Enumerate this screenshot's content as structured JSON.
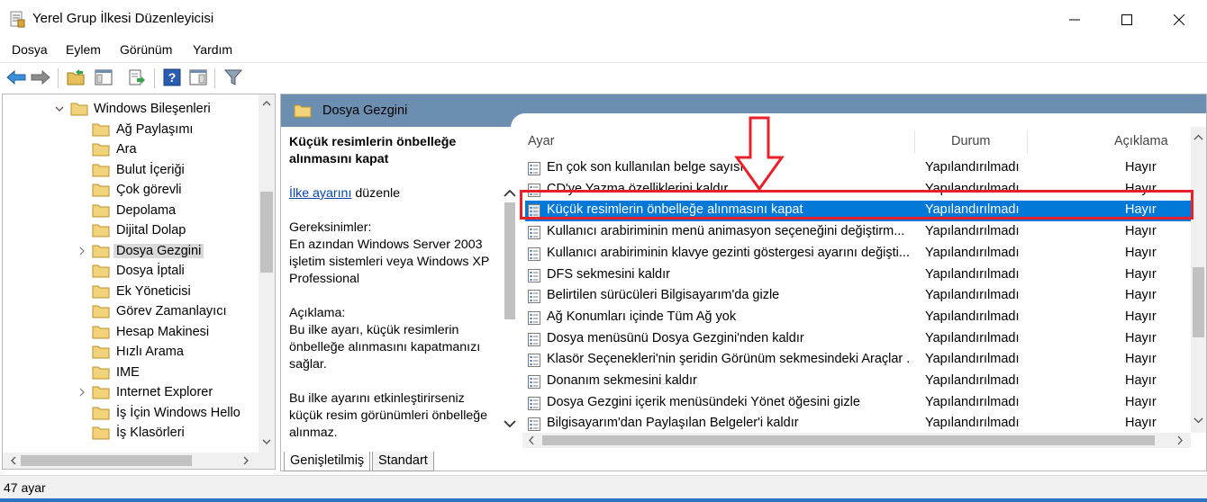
{
  "window": {
    "title": "Yerel Grup İlkesi Düzenleyicisi"
  },
  "menubar": {
    "items": [
      "Dosya",
      "Eylem",
      "Görünüm",
      "Yardım"
    ]
  },
  "tree": {
    "items": [
      {
        "label": "Windows Bileşenleri",
        "expandable": true,
        "expanded": true
      },
      {
        "label": "Ağ Paylaşımı"
      },
      {
        "label": "Ara"
      },
      {
        "label": "Bulut İçeriği"
      },
      {
        "label": "Çok görevli"
      },
      {
        "label": "Depolama"
      },
      {
        "label": "Dijital Dolap"
      },
      {
        "label": "Dosya Gezgini",
        "expandable": true,
        "selected": true
      },
      {
        "label": "Dosya İptali"
      },
      {
        "label": "Ek Yöneticisi"
      },
      {
        "label": "Görev Zamanlayıcı"
      },
      {
        "label": "Hesap Makinesi"
      },
      {
        "label": "Hızlı Arama"
      },
      {
        "label": "IME"
      },
      {
        "label": "Internet Explorer",
        "expandable": true
      },
      {
        "label": "İş İçin Windows Hello"
      },
      {
        "label": "İş Klasörleri"
      }
    ]
  },
  "right_pane": {
    "header_title": "Dosya Gezgini",
    "description": {
      "title": "Küçük resimlerin önbelleğe alınmasını kapat",
      "edit_link": "İlke ayarını",
      "edit_suffix": "düzenle",
      "requirements_label": "Gereksinimler:",
      "requirements_text": "En azından Windows Server 2003 işletim sistemleri veya Windows XP Professional",
      "description_label": "Açıklama:",
      "description_text": "Bu ilke ayarı, küçük resimlerin önbelleğe alınmasını kapatmanızı sağlar.",
      "description_text2": "Bu ilke ayarını etkinleştirirseniz küçük resim görünümleri önbelleğe alınmaz."
    },
    "columns": {
      "setting": "Ayar",
      "state": "Durum",
      "comment": "Açıklama"
    },
    "rows": [
      {
        "name": "En çok son kullanılan belge sayısı",
        "state": "Yapılandırılmadı",
        "comment": "Hayır"
      },
      {
        "name": "CD'ye Yazma özelliklerini kaldır",
        "state": "Yapılandırılmadı",
        "comment": "Hayır"
      },
      {
        "name": "Küçük resimlerin önbelleğe alınmasını kapat",
        "state": "Yapılandırılmadı",
        "comment": "Hayır",
        "selected": true
      },
      {
        "name": "Kullanıcı arabiriminin menü animasyon seçeneğini değiştirm...",
        "state": "Yapılandırılmadı",
        "comment": "Hayır"
      },
      {
        "name": "Kullanıcı arabiriminin klavye gezinti göstergesi ayarını değişti...",
        "state": "Yapılandırılmadı",
        "comment": "Hayır"
      },
      {
        "name": "DFS sekmesini kaldır",
        "state": "Yapılandırılmadı",
        "comment": "Hayır"
      },
      {
        "name": "Belirtilen sürücüleri Bilgisayarım'da gizle",
        "state": "Yapılandırılmadı",
        "comment": "Hayır"
      },
      {
        "name": "Ağ Konumları içinde Tüm Ağ yok",
        "state": "Yapılandırılmadı",
        "comment": "Hayır"
      },
      {
        "name": "Dosya menüsünü Dosya Gezgini'nden kaldır",
        "state": "Yapılandırılmadı",
        "comment": "Hayır"
      },
      {
        "name": "Klasör Seçenekleri'nin şeridin Görünüm sekmesindeki Araçlar ...",
        "state": "Yapılandırılmadı",
        "comment": "Hayır"
      },
      {
        "name": "Donanım sekmesini kaldır",
        "state": "Yapılandırılmadı",
        "comment": "Hayır"
      },
      {
        "name": "Dosya Gezgini içerik menüsündeki Yönet öğesini gizle",
        "state": "Yapılandırılmadı",
        "comment": "Hayır"
      },
      {
        "name": "Bilgisayarım'dan Paylaşılan Belgeler'i kaldır",
        "state": "Yapılandırılmadı",
        "comment": "Hayır"
      }
    ]
  },
  "tabs": {
    "extended": "Genişletilmiş",
    "standard": "Standart"
  },
  "status": {
    "text": "47 ayar"
  },
  "colors": {
    "selection": "#0078d7",
    "header": "#6c8eb1",
    "annotation": "#e8202a",
    "link": "#0645ad"
  },
  "icons": [
    "app-policy-icon",
    "back-arrow-icon",
    "forward-arrow-icon",
    "up-folder-icon",
    "show-hide-tree-icon",
    "export-list-icon",
    "help-icon",
    "properties-icon",
    "filter-icon",
    "folder-icon",
    "policy-setting-icon",
    "annotation-down-arrow-icon"
  ]
}
